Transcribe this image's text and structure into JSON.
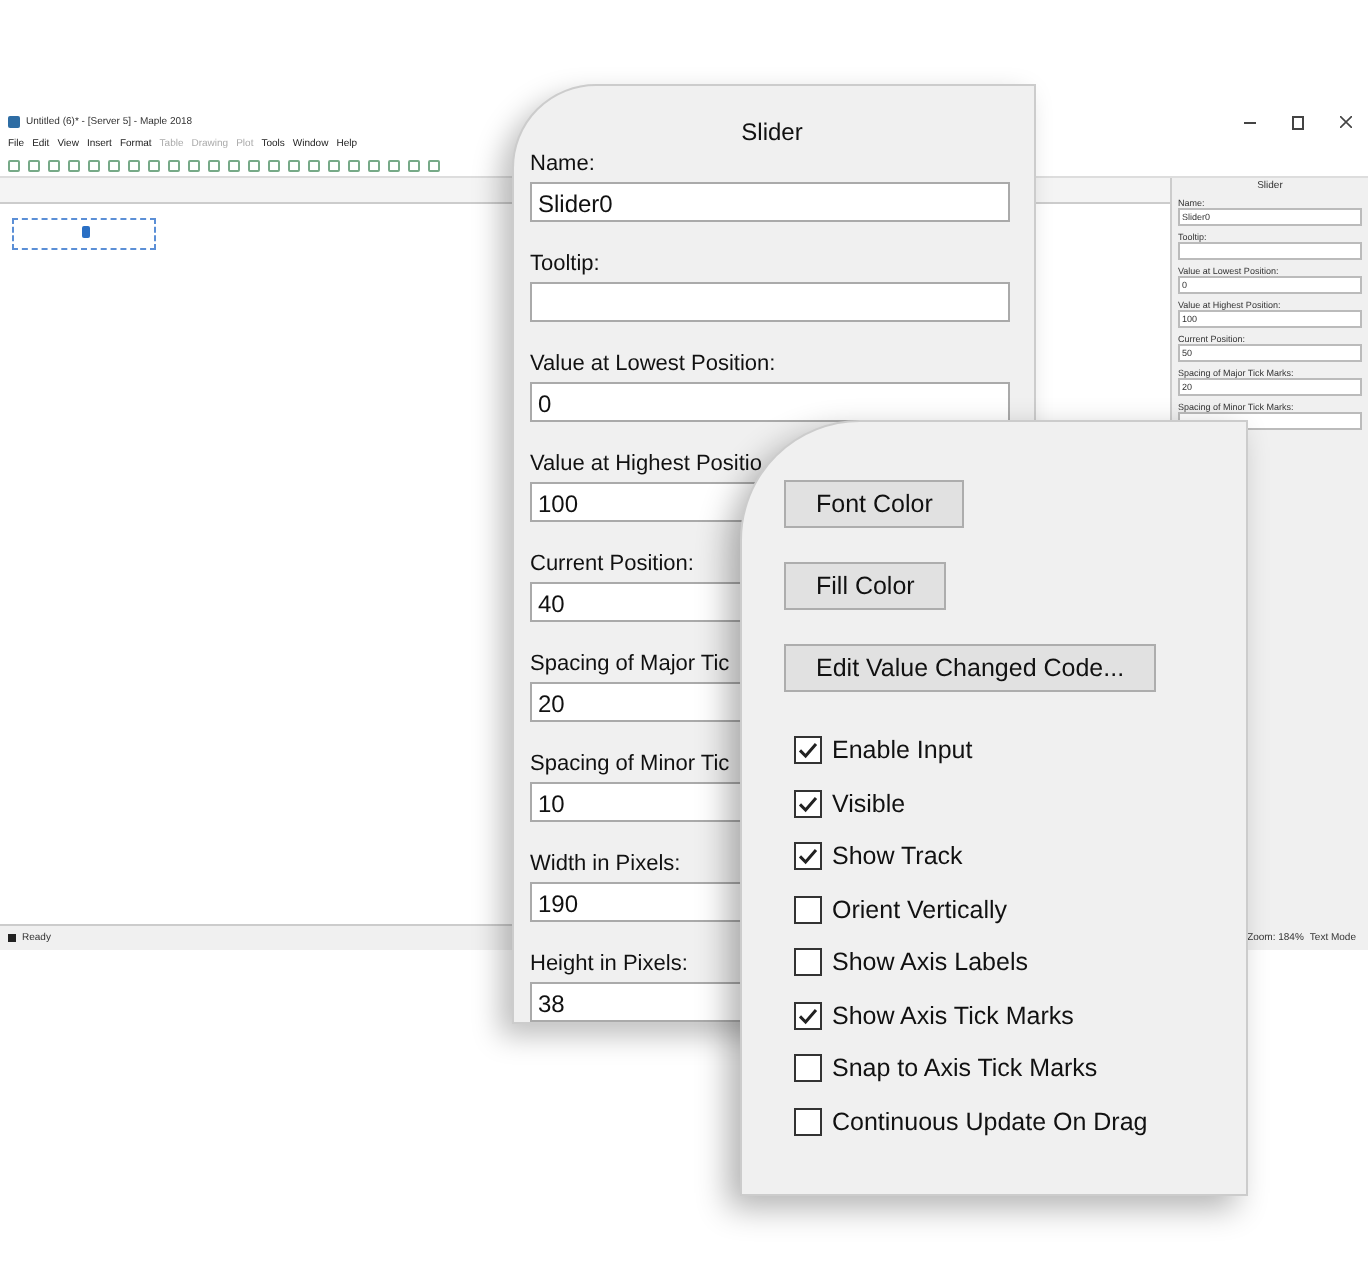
{
  "window": {
    "title": "Untitled (6)* - [Server 5] - Maple 2018"
  },
  "menu": [
    {
      "label": "File",
      "disabled": false
    },
    {
      "label": "Edit",
      "disabled": false
    },
    {
      "label": "View",
      "disabled": false
    },
    {
      "label": "Insert",
      "disabled": false
    },
    {
      "label": "Format",
      "disabled": false
    },
    {
      "label": "Table",
      "disabled": true
    },
    {
      "label": "Drawing",
      "disabled": true
    },
    {
      "label": "Plot",
      "disabled": true
    },
    {
      "label": "Tools",
      "disabled": false
    },
    {
      "label": "Window",
      "disabled": false
    },
    {
      "label": "Help",
      "disabled": false
    }
  ],
  "side_panel": {
    "title": "Slider",
    "fields": [
      {
        "label": "Name:",
        "value": "Slider0"
      },
      {
        "label": "Tooltip:"
      },
      {
        "label": "Value at Lowest Position:",
        "value": "0"
      },
      {
        "label": "Value at Highest Position:",
        "value": "100"
      },
      {
        "label": "Current Position:",
        "value": "50"
      },
      {
        "label": "Spacing of Major Tick Marks:",
        "value": "20"
      },
      {
        "label": "Spacing of Minor Tick Marks:"
      }
    ]
  },
  "status_bar": {
    "left": "Ready",
    "zoom": "Zoom: 184%",
    "mode": "Text Mode"
  },
  "callout_properties": {
    "title": "Slider",
    "fields": [
      {
        "label": "Name:",
        "value": "Slider0"
      },
      {
        "label": "Tooltip:"
      },
      {
        "label": "Value at Lowest Position:",
        "value": "0"
      },
      {
        "label": "Value at Highest Positio",
        "value": "100"
      },
      {
        "label": "Current Position:",
        "value": "40"
      },
      {
        "label": "Spacing of Major Tic",
        "value": "20"
      },
      {
        "label": "Spacing of Minor Tic",
        "value": "10"
      },
      {
        "label": "Width in Pixels:",
        "value": "190"
      },
      {
        "label": "Height in Pixels:",
        "value": "38"
      }
    ]
  },
  "callout_options": {
    "buttons": [
      "Font Color",
      "Fill Color",
      "Edit Value Changed Code..."
    ],
    "checkboxes": [
      {
        "label": "Enable Input",
        "checked": true
      },
      {
        "label": "Visible",
        "checked": true
      },
      {
        "label": "Show Track",
        "checked": true
      },
      {
        "label": "Orient Vertically",
        "checked": false
      },
      {
        "label": "Show Axis Labels",
        "checked": false
      },
      {
        "label": "Show Axis Tick Marks",
        "checked": true
      },
      {
        "label": "Snap to Axis Tick Marks",
        "checked": false
      },
      {
        "label": "Continuous Update On Drag",
        "checked": false
      }
    ]
  }
}
